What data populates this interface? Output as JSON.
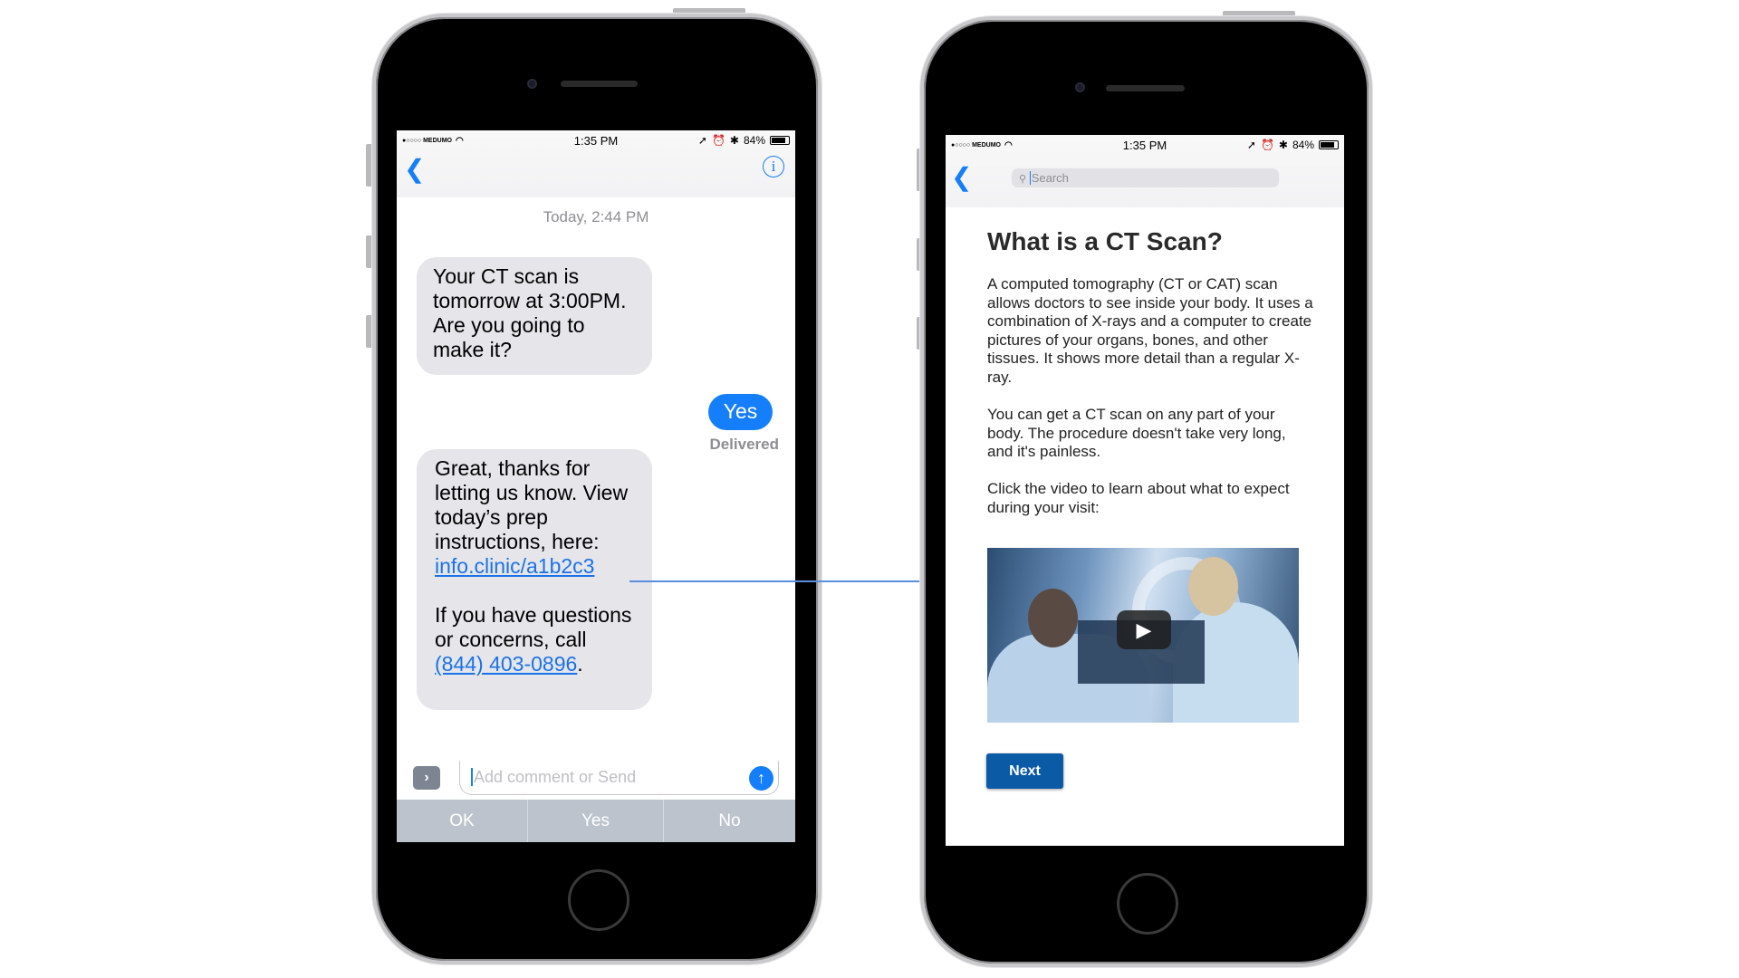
{
  "status_bar": {
    "carrier": "●○○○○ MEDUMO",
    "time": "1:35 PM",
    "battery": "84%",
    "icons": [
      "wifi-icon",
      "location-icon",
      "alarm-icon",
      "bluetooth-icon",
      "battery-icon"
    ]
  },
  "messages": {
    "timestamp": "Today, 2:44 PM",
    "incoming_1": "Your CT scan is tomorrow at 3:00PM. Are you going to make it?",
    "outgoing_1": "Yes",
    "delivered": "Delivered",
    "incoming_2_text": "Great, thanks for letting us know. View today’s prep instructions, here:",
    "incoming_2_link": "info.clinic/a1b2c3",
    "incoming_2_text2": "If you have questions or concerns, call",
    "incoming_2_phone": "(844) 403-0896",
    "incoming_2_end": ".",
    "input_placeholder": "Add comment or Send",
    "quick_replies": [
      "OK",
      "Yes",
      "No"
    ]
  },
  "article": {
    "search_placeholder": "Search",
    "title": "What is a CT Scan?",
    "paragraphs": [
      "A computed tomography (CT or CAT) scan allows doctors to see inside your body. It uses a combination of X-rays and a computer to create pictures of your organs, bones, and other tissues. It shows more detail than a regular X-ray.",
      "You can get a CT scan on any part of your body. The procedure doesn't take very long, and it's painless.",
      "Click the video to learn about what to expect during your visit:"
    ],
    "next_label": "Next"
  },
  "colors": {
    "ios_blue": "#157efb",
    "link_blue": "#1a73e8",
    "next_button": "#0b5aa5",
    "bubble_gray": "#e5e5ea",
    "quick_reply_bar": "#bcc3cc"
  }
}
